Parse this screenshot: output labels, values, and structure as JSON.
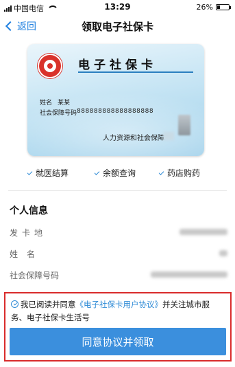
{
  "status_bar": {
    "carrier": "中国电信",
    "time": "13:29",
    "battery_percent": "26%",
    "battery_level": 0.26
  },
  "nav": {
    "back_label": "返回",
    "title": "领取电子社保卡"
  },
  "card": {
    "title": "电子社保卡",
    "name_label": "姓名",
    "name_value": "某某",
    "ssn_label": "社会保障号码",
    "ssn_value": "888888888888888888",
    "issuer": "人力资源和社会保障"
  },
  "features": [
    "就医结算",
    "余额查询",
    "药店购药"
  ],
  "personal_info": {
    "title": "个人信息",
    "rows": [
      {
        "label": "发卡地"
      },
      {
        "label": "姓名"
      },
      {
        "label": "社会保障号码"
      }
    ]
  },
  "agreement": {
    "text_before": "我已阅读并同意",
    "link": "《电子社保卡用户协议》",
    "text_after": "并关注城市服务、电子社保卡生活号",
    "button_label": "同意协议并领取"
  },
  "colors": {
    "accent": "#3b8fdd",
    "link": "#2f8bd6",
    "highlight_border": "#d92b2b",
    "emblem": "#d9322b"
  },
  "icons": [
    "signal-icon",
    "wifi-icon",
    "battery-icon",
    "back-chevron-icon",
    "check-icon",
    "agree-check-icon",
    "emblem-icon"
  ]
}
